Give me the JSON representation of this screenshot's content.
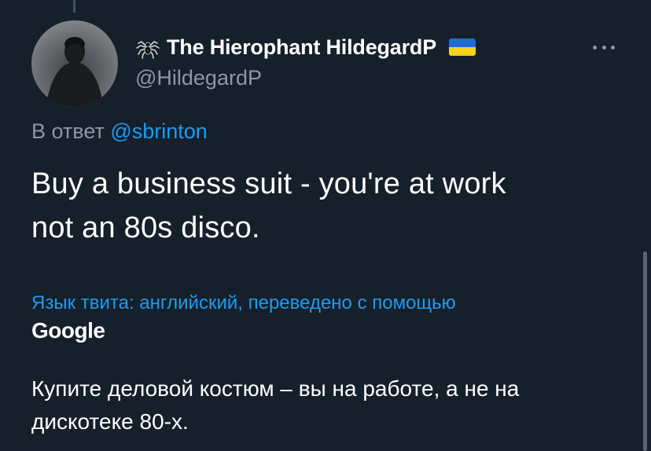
{
  "author": {
    "display_name": "The Hierophant HildegardP",
    "handle": "@HildegardP",
    "avatar_icon": "person-silhouette",
    "name_prefix_icon": "spider-icon",
    "name_suffix_icon": "ukraine-flag-icon"
  },
  "reply": {
    "prefix": "В ответ",
    "mention": "@sbrinton"
  },
  "tweet": {
    "text_line1": "Buy a business suit - you're at work",
    "text_line2": "not an 80s disco."
  },
  "translation": {
    "label": "Язык твита: английский, переведено с помощью",
    "provider": "Google",
    "text_line1": "Купите деловой костюм – вы на работе, а не на",
    "text_line2": "дискотеке 80-х."
  },
  "colors": {
    "background": "#15202b",
    "link": "#1d9bf0",
    "secondary_text": "#8b98a5",
    "primary_text": "#ffffff"
  }
}
